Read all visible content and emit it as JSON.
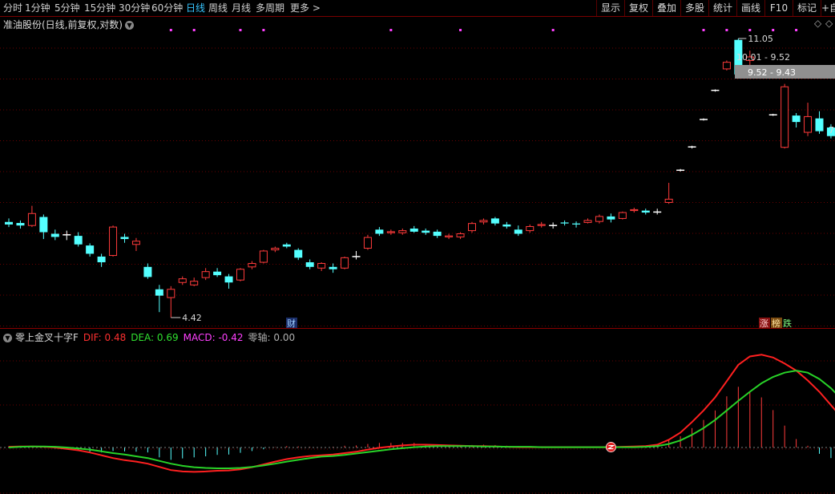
{
  "toolbar": {
    "periods": [
      "分时",
      "1分钟",
      "5分钟",
      "15分钟",
      "30分钟",
      "60分钟",
      "日线",
      "周线",
      "月线",
      "多周期",
      "更多 >"
    ],
    "active_period": "日线",
    "right_buttons": [
      "显示",
      "复权",
      "叠加",
      "多股",
      "统计",
      "画线",
      "F10",
      "标记",
      "+自"
    ]
  },
  "main_chart": {
    "title": "准油股份(日线,前复权,对数)",
    "high_label": "11.05",
    "low_label": "4.42",
    "range_label_1": "10.01 - 9.52",
    "range_label_2": "9.52 - 9.43",
    "edge_label": "7",
    "finance_badge": "财",
    "zhang_badge": "涨",
    "bang_badge": "榜",
    "die_badge": "跌"
  },
  "indicator": {
    "name": "零上金叉十字F",
    "dif_label": "DIF: 0.48",
    "dea_label": "DEA: 0.69",
    "macd_label": "MACD: -0.42",
    "zero_label": "零轴: 0.00"
  },
  "colors": {
    "up": "#ff3b3b",
    "down": "#54ffff",
    "dif": "#ff2020",
    "dea": "#28d228",
    "macd_label": "#ff40ff",
    "grid": "#6a0000",
    "marker": "#ff40ff"
  },
  "chart_data": {
    "type": "candlestick",
    "candles": [
      {
        "o": 6.05,
        "c": 6.0,
        "h": 6.12,
        "l": 5.95
      },
      {
        "o": 6.03,
        "c": 5.98,
        "h": 6.08,
        "l": 5.92
      },
      {
        "o": 5.98,
        "c": 6.22,
        "h": 6.38,
        "l": 5.95
      },
      {
        "o": 6.15,
        "c": 5.85,
        "h": 6.2,
        "l": 5.72
      },
      {
        "o": 5.82,
        "c": 5.76,
        "h": 5.9,
        "l": 5.7
      },
      {
        "o": 5.8,
        "c": 5.8,
        "h": 5.88,
        "l": 5.7
      },
      {
        "o": 5.78,
        "c": 5.62,
        "h": 5.85,
        "l": 5.58
      },
      {
        "o": 5.6,
        "c": 5.45,
        "h": 5.64,
        "l": 5.4
      },
      {
        "o": 5.4,
        "c": 5.3,
        "h": 5.45,
        "l": 5.22
      },
      {
        "o": 5.42,
        "c": 5.95,
        "h": 5.98,
        "l": 5.4
      },
      {
        "o": 5.76,
        "c": 5.72,
        "h": 5.82,
        "l": 5.65
      },
      {
        "o": 5.62,
        "c": 5.68,
        "h": 5.74,
        "l": 5.5
      },
      {
        "o": 5.22,
        "c": 5.05,
        "h": 5.28,
        "l": 5.02
      },
      {
        "o": 4.85,
        "c": 4.75,
        "h": 4.92,
        "l": 4.5
      },
      {
        "o": 4.72,
        "c": 4.85,
        "h": 4.9,
        "l": 4.42
      },
      {
        "o": 4.96,
        "c": 5.02,
        "h": 5.06,
        "l": 4.92
      },
      {
        "o": 4.92,
        "c": 4.98,
        "h": 5.04,
        "l": 4.9
      },
      {
        "o": 5.04,
        "c": 5.14,
        "h": 5.2,
        "l": 5.0
      },
      {
        "o": 5.14,
        "c": 5.08,
        "h": 5.2,
        "l": 5.05
      },
      {
        "o": 5.06,
        "c": 4.96,
        "h": 5.1,
        "l": 4.86
      },
      {
        "o": 5.0,
        "c": 5.18,
        "h": 5.2,
        "l": 4.98
      },
      {
        "o": 5.22,
        "c": 5.28,
        "h": 5.32,
        "l": 5.18
      },
      {
        "o": 5.3,
        "c": 5.5,
        "h": 5.52,
        "l": 5.28
      },
      {
        "o": 5.52,
        "c": 5.55,
        "h": 5.58,
        "l": 5.48
      },
      {
        "o": 5.62,
        "c": 5.58,
        "h": 5.65,
        "l": 5.55
      },
      {
        "o": 5.52,
        "c": 5.38,
        "h": 5.55,
        "l": 5.34
      },
      {
        "o": 5.3,
        "c": 5.22,
        "h": 5.35,
        "l": 5.18
      },
      {
        "o": 5.2,
        "c": 5.28,
        "h": 5.3,
        "l": 5.15
      },
      {
        "o": 5.22,
        "c": 5.18,
        "h": 5.28,
        "l": 5.12
      },
      {
        "o": 5.2,
        "c": 5.38,
        "h": 5.4,
        "l": 5.18
      },
      {
        "o": 5.4,
        "c": 5.4,
        "h": 5.5,
        "l": 5.35
      },
      {
        "o": 5.55,
        "c": 5.75,
        "h": 5.8,
        "l": 5.52
      },
      {
        "o": 5.9,
        "c": 5.82,
        "h": 5.95,
        "l": 5.78
      },
      {
        "o": 5.84,
        "c": 5.86,
        "h": 5.9,
        "l": 5.8
      },
      {
        "o": 5.84,
        "c": 5.88,
        "h": 5.92,
        "l": 5.8
      },
      {
        "o": 5.92,
        "c": 5.86,
        "h": 5.97,
        "l": 5.84
      },
      {
        "o": 5.88,
        "c": 5.84,
        "h": 5.92,
        "l": 5.8
      },
      {
        "o": 5.86,
        "c": 5.78,
        "h": 5.9,
        "l": 5.74
      },
      {
        "o": 5.76,
        "c": 5.78,
        "h": 5.82,
        "l": 5.72
      },
      {
        "o": 5.76,
        "c": 5.82,
        "h": 5.85,
        "l": 5.72
      },
      {
        "o": 5.88,
        "c": 6.02,
        "h": 6.05,
        "l": 5.84
      },
      {
        "o": 6.05,
        "c": 6.08,
        "h": 6.12,
        "l": 6.0
      },
      {
        "o": 6.12,
        "c": 6.02,
        "h": 6.15,
        "l": 5.98
      },
      {
        "o": 6.0,
        "c": 5.96,
        "h": 6.05,
        "l": 5.92
      },
      {
        "o": 5.9,
        "c": 5.82,
        "h": 5.98,
        "l": 5.78
      },
      {
        "o": 5.88,
        "c": 5.96,
        "h": 6.0,
        "l": 5.84
      },
      {
        "o": 5.98,
        "c": 6.0,
        "h": 6.05,
        "l": 5.94
      },
      {
        "o": 5.98,
        "c": 5.98,
        "h": 6.04,
        "l": 5.92
      },
      {
        "o": 6.04,
        "c": 6.02,
        "h": 6.08,
        "l": 5.98
      },
      {
        "o": 6.02,
        "c": 6.0,
        "h": 6.06,
        "l": 5.94
      },
      {
        "o": 6.04,
        "c": 6.08,
        "h": 6.12,
        "l": 6.02
      },
      {
        "o": 6.06,
        "c": 6.16,
        "h": 6.2,
        "l": 6.02
      },
      {
        "o": 6.16,
        "c": 6.1,
        "h": 6.22,
        "l": 6.04
      },
      {
        "o": 6.12,
        "c": 6.24,
        "h": 6.26,
        "l": 6.1
      },
      {
        "o": 6.28,
        "c": 6.3,
        "h": 6.34,
        "l": 6.24
      },
      {
        "o": 6.28,
        "c": 6.24,
        "h": 6.32,
        "l": 6.2
      },
      {
        "o": 6.25,
        "c": 6.25,
        "h": 6.32,
        "l": 6.2
      },
      {
        "o": 6.45,
        "c": 6.52,
        "h": 6.88,
        "l": 6.42
      },
      {
        "o": 7.17,
        "c": 7.17,
        "h": 7.2,
        "l": 7.14
      },
      {
        "o": 7.74,
        "c": 7.74,
        "h": 7.77,
        "l": 7.7
      },
      {
        "o": 8.47,
        "c": 8.47,
        "h": 8.5,
        "l": 8.44
      },
      {
        "o": 9.32,
        "c": 9.32,
        "h": 9.35,
        "l": 9.28
      },
      {
        "o": 10.0,
        "c": 10.22,
        "h": 10.28,
        "l": 9.95
      },
      {
        "o": 11.0,
        "c": 9.82,
        "h": 11.05,
        "l": 9.78
      },
      {
        "o": 10.28,
        "c": 10.4,
        "h": 10.62,
        "l": 9.68
      },
      {
        "o": 9.75,
        "c": 9.75,
        "h": 9.78,
        "l": 9.72
      },
      {
        "o": 8.6,
        "c": 8.6,
        "h": 8.63,
        "l": 8.57
      },
      {
        "o": 7.73,
        "c": 9.43,
        "h": 9.52,
        "l": 7.7
      },
      {
        "o": 8.58,
        "c": 8.4,
        "h": 8.65,
        "l": 8.25
      },
      {
        "o": 8.12,
        "c": 8.55,
        "h": 8.95,
        "l": 8.02
      },
      {
        "o": 8.5,
        "c": 8.15,
        "h": 8.7,
        "l": 8.08
      },
      {
        "o": 8.25,
        "c": 8.02,
        "h": 8.34,
        "l": 7.96
      },
      {
        "o": 8.12,
        "c": 7.72,
        "h": 8.16,
        "l": 7.68
      },
      {
        "o": 7.78,
        "c": 7.55,
        "h": 7.82,
        "l": 7.5
      }
    ],
    "macd": [
      0.04,
      0.03,
      0.03,
      0.01,
      -0.03,
      -0.05,
      -0.07,
      -0.12,
      -0.14,
      -0.1,
      -0.11,
      -0.12,
      -0.14,
      -0.28,
      -0.35,
      -0.31,
      -0.28,
      -0.25,
      -0.21,
      -0.2,
      -0.15,
      -0.1,
      -0.05,
      0.01,
      0.04,
      0.03,
      0.02,
      0.01,
      0.02,
      0.05,
      0.06,
      0.1,
      0.13,
      0.13,
      0.13,
      0.13,
      0.1,
      0.08,
      0.07,
      0.06,
      0.07,
      0.08,
      0.07,
      0.05,
      0.04,
      0.03,
      0.03,
      0.02,
      0.02,
      0.01,
      0.01,
      0.01,
      0.02,
      0.02,
      0.03,
      0.04,
      0.08,
      0.2,
      0.32,
      0.55,
      0.78,
      1.05,
      1.45,
      1.72,
      1.6,
      1.42,
      1.06,
      0.62,
      0.24,
      0.05,
      -0.18,
      -0.3,
      -0.42
    ],
    "dif": [
      0.02,
      0.03,
      0.03,
      0.02,
      0.0,
      -0.04,
      -0.08,
      -0.14,
      -0.22,
      -0.3,
      -0.36,
      -0.4,
      -0.46,
      -0.55,
      -0.64,
      -0.68,
      -0.69,
      -0.68,
      -0.66,
      -0.65,
      -0.62,
      -0.56,
      -0.48,
      -0.4,
      -0.33,
      -0.28,
      -0.24,
      -0.22,
      -0.2,
      -0.16,
      -0.12,
      -0.06,
      -0.01,
      0.03,
      0.06,
      0.08,
      0.08,
      0.07,
      0.06,
      0.05,
      0.04,
      0.04,
      0.03,
      0.02,
      0.01,
      0.01,
      0.01,
      0.01,
      0.01,
      0.01,
      0.01,
      0.01,
      0.01,
      0.02,
      0.03,
      0.04,
      0.08,
      0.22,
      0.42,
      0.72,
      1.05,
      1.42,
      1.88,
      2.34,
      2.58,
      2.63,
      2.55,
      2.38,
      2.18,
      1.9,
      1.58,
      1.2,
      0.82,
      0.48
    ],
    "dea": [
      0.0,
      0.02,
      0.03,
      0.03,
      0.02,
      0.0,
      -0.03,
      -0.06,
      -0.11,
      -0.16,
      -0.2,
      -0.25,
      -0.3,
      -0.38,
      -0.46,
      -0.52,
      -0.56,
      -0.58,
      -0.59,
      -0.59,
      -0.58,
      -0.55,
      -0.51,
      -0.46,
      -0.4,
      -0.35,
      -0.3,
      -0.26,
      -0.24,
      -0.21,
      -0.17,
      -0.13,
      -0.09,
      -0.05,
      -0.02,
      0.01,
      0.03,
      0.04,
      0.04,
      0.04,
      0.04,
      0.03,
      0.03,
      0.02,
      0.02,
      0.02,
      0.01,
      0.01,
      0.01,
      0.01,
      0.01,
      0.01,
      0.01,
      0.01,
      0.01,
      0.02,
      0.04,
      0.1,
      0.2,
      0.36,
      0.55,
      0.78,
      1.05,
      1.32,
      1.58,
      1.82,
      2.0,
      2.12,
      2.18,
      2.12,
      1.94,
      1.68,
      1.34,
      0.69
    ],
    "markers_top": [
      14,
      16,
      20,
      22,
      33,
      39,
      47,
      60,
      62,
      64,
      66,
      68
    ],
    "cross_marker_index": 52
  }
}
